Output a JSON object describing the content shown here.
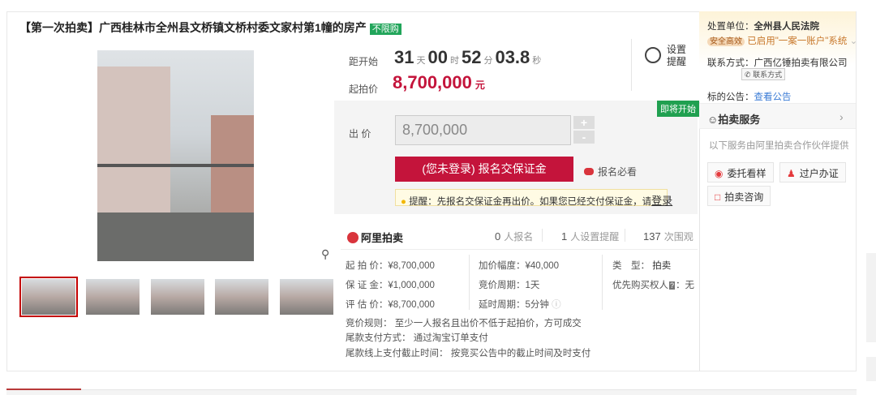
{
  "title": "【第一次拍卖】广西桂林市全州县文桥镇文桥村委文家村第1幢的房产",
  "title_tag": "不限购",
  "countdown": {
    "label": "距开始",
    "days": "31",
    "days_unit": "天",
    "hours": "00",
    "hours_unit": "时",
    "minutes": "52",
    "minutes_unit": "分",
    "seconds": "03.8",
    "seconds_unit": "秒"
  },
  "reminder_label": "设置提醒",
  "start_price": {
    "label": "起拍价",
    "value": "8,700,000",
    "unit": "元"
  },
  "status_badge": "即将开始",
  "bid": {
    "label": "出 价",
    "value": "8,700,000",
    "plus": "+",
    "minus": "-"
  },
  "register_button": "(您未登录) 报名交保证金",
  "must_read": "报名必看",
  "tip": {
    "text": "提醒：先报名交保证金再出价。如果您已经交付保证金，请",
    "link": "登录"
  },
  "platform": "阿里拍卖",
  "stats": [
    {
      "num": "0",
      "label": "人报名"
    },
    {
      "num": "1",
      "label": "人设置提醒"
    },
    {
      "num": "137",
      "label": "次围观"
    }
  ],
  "info": {
    "start_price": "起 拍 价：¥8,700,000",
    "deposit": "保 证 金：¥1,000,000",
    "appraisal": "评 估 价：¥8,700,000",
    "increment": "加价幅度：¥40,000",
    "cycle": "竞价周期：1天",
    "delay": "延时周期：5分钟",
    "type_label": "类　型：",
    "type_value": "拍卖",
    "priority": "优先购买权人",
    "priority_value": "：无",
    "rule": "竞价规则：  至少一人报名且出价不低于起拍价，方可成交",
    "payment": "尾款支付方式：  通过淘宝订单支付",
    "deadline": "尾款线上支付截止时间：  按竞买公告中的截止时间及时支付"
  },
  "right": {
    "court_label": "处置单位：",
    "court": "全州县人民法院",
    "safe_badge": "安全高效",
    "safe_text": "已启用\"一案一账户\"系统",
    "contact_label": "联系方式：",
    "contact": "广西亿锤拍卖有限公司",
    "contact_btn": "联系方式",
    "notice_label": "标的公告：",
    "notice_link": "查看公告",
    "service_title": "拍卖服务",
    "service_desc": "以下服务由阿里拍卖合作伙伴提供",
    "services": [
      "委托看样",
      "过户办证",
      "拍卖咨询"
    ]
  },
  "colors": {
    "accent": "#c4143b",
    "green": "#20a050"
  }
}
